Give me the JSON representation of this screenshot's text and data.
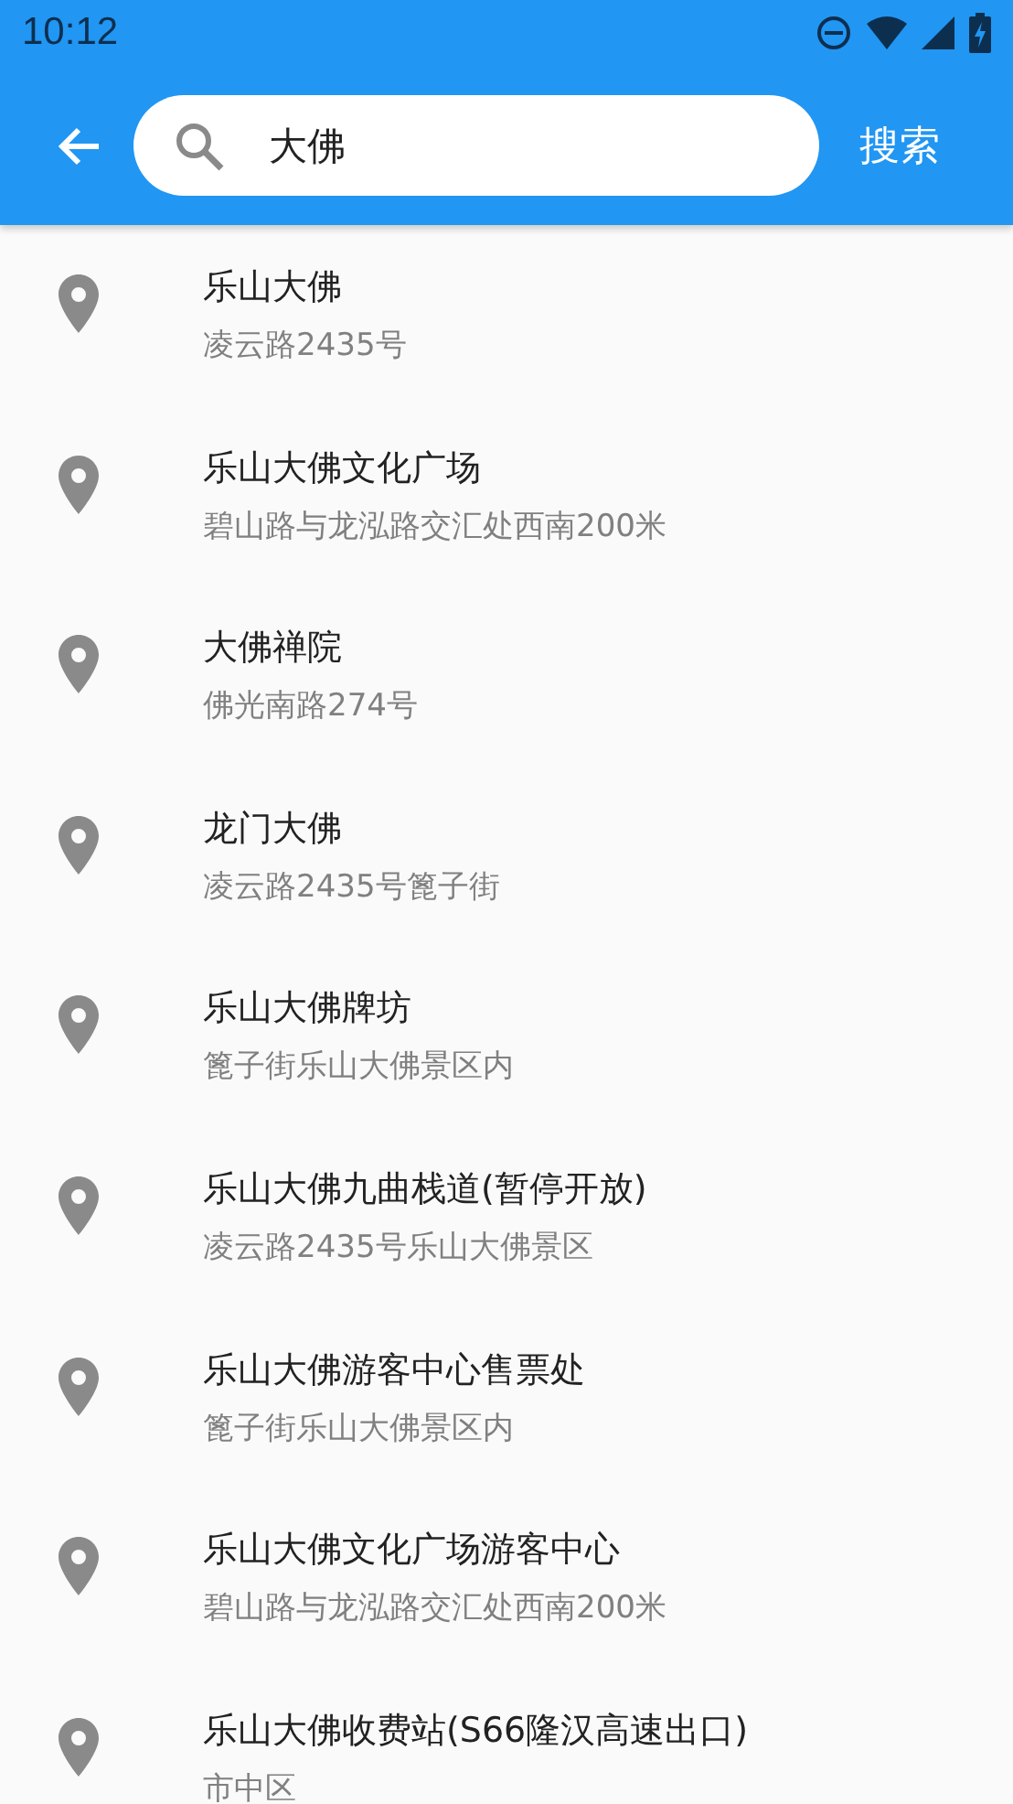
{
  "status_bar": {
    "time": "10:12"
  },
  "app_bar": {
    "search": {
      "value": "大佛"
    },
    "search_button": "搜索"
  },
  "results": [
    {
      "name": "乐山大佛",
      "address": "凌云路2435号"
    },
    {
      "name": "乐山大佛文化广场",
      "address": "碧山路与龙泓路交汇处西南200米"
    },
    {
      "name": "大佛禅院",
      "address": "佛光南路274号"
    },
    {
      "name": "龙门大佛",
      "address": "凌云路2435号篦子街"
    },
    {
      "name": "乐山大佛牌坊",
      "address": "篦子街乐山大佛景区内"
    },
    {
      "name": "乐山大佛九曲栈道(暂停开放)",
      "address": "凌云路2435号乐山大佛景区"
    },
    {
      "name": "乐山大佛游客中心售票处",
      "address": "篦子街乐山大佛景区内"
    },
    {
      "name": "乐山大佛文化广场游客中心",
      "address": "碧山路与龙泓路交汇处西南200米"
    },
    {
      "name": "乐山大佛收费站(S66隆汉高速出口)",
      "address": "市中区"
    }
  ]
}
